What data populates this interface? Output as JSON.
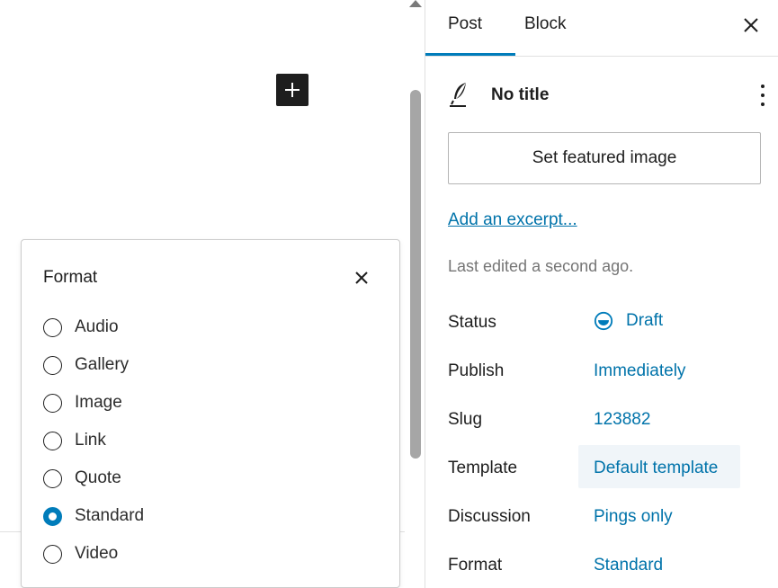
{
  "format_popover": {
    "title": "Format",
    "options": [
      {
        "label": "Audio",
        "checked": false
      },
      {
        "label": "Gallery",
        "checked": false
      },
      {
        "label": "Image",
        "checked": false
      },
      {
        "label": "Link",
        "checked": false
      },
      {
        "label": "Quote",
        "checked": false
      },
      {
        "label": "Standard",
        "checked": true
      },
      {
        "label": "Video",
        "checked": false
      }
    ]
  },
  "sidebar": {
    "tabs": [
      {
        "label": "Post",
        "active": true
      },
      {
        "label": "Block",
        "active": false
      }
    ],
    "post_title": "No title",
    "featured_image_label": "Set featured image",
    "excerpt_link": "Add an excerpt...",
    "last_edited": "Last edited a second ago.",
    "rows": {
      "status": {
        "label": "Status",
        "value": "Draft"
      },
      "publish": {
        "label": "Publish",
        "value": "Immediately"
      },
      "slug": {
        "label": "Slug",
        "value": "123882"
      },
      "template": {
        "label": "Template",
        "value": "Default template"
      },
      "discussion": {
        "label": "Discussion",
        "value": "Pings only"
      },
      "format": {
        "label": "Format",
        "value": "Standard"
      }
    }
  },
  "colors": {
    "accent": "#007cba",
    "link": "#0073aa",
    "inserter_bg": "#1e1e1e"
  },
  "icons": {
    "inserter": "plus-icon",
    "close": "close-icon",
    "post_type": "feather-pen-icon",
    "more": "more-vertical-icon",
    "status": "draft-status-icon"
  }
}
